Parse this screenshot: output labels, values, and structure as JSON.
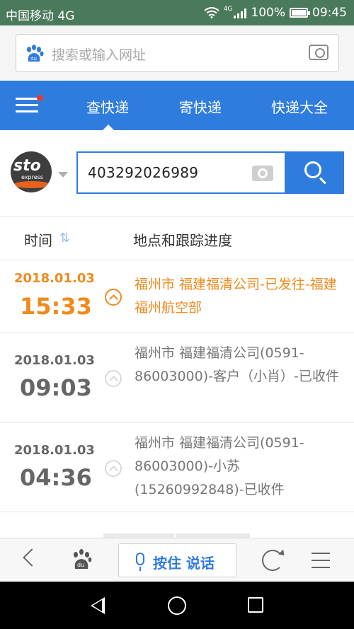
{
  "status_bar": {
    "carrier": "中国移动 4G",
    "network": "4G",
    "battery": "100%",
    "battery_level": 1.0,
    "time": "09:45"
  },
  "search": {
    "placeholder": "搜索或输入网址"
  },
  "tabs": [
    {
      "label": "查快递",
      "active": true
    },
    {
      "label": "寄快递",
      "active": false
    },
    {
      "label": "快递大全",
      "active": false
    }
  ],
  "courier": {
    "brand": "sto",
    "brand_sub": "express",
    "tracking_number": "403292026989"
  },
  "columns": {
    "time": "时间",
    "sort_glyph": "⇅",
    "progress": "地点和跟踪进度"
  },
  "events": [
    {
      "date": "2018.01.03",
      "time": "15:33",
      "desc": "福州市 福建福清公司-已发往-福建福州航空部",
      "active": true
    },
    {
      "date": "2018.01.03",
      "time": "09:03",
      "desc": "福州市 福建福清公司(0591-86003000)-客户（小肖）-已收件",
      "active": false
    },
    {
      "date": "2018.01.03",
      "time": "04:36",
      "desc": "福州市 福建福清公司(0591-86003000)-小苏(15260992848)-已收件",
      "active": false
    }
  ],
  "toolbar": {
    "voice_label": "按住 说话"
  },
  "colors": {
    "status_bar": "#4a7a5b",
    "brand_blue": "#2f7cdf",
    "active_orange": "#f08a1c",
    "muted_text": "#777777"
  }
}
